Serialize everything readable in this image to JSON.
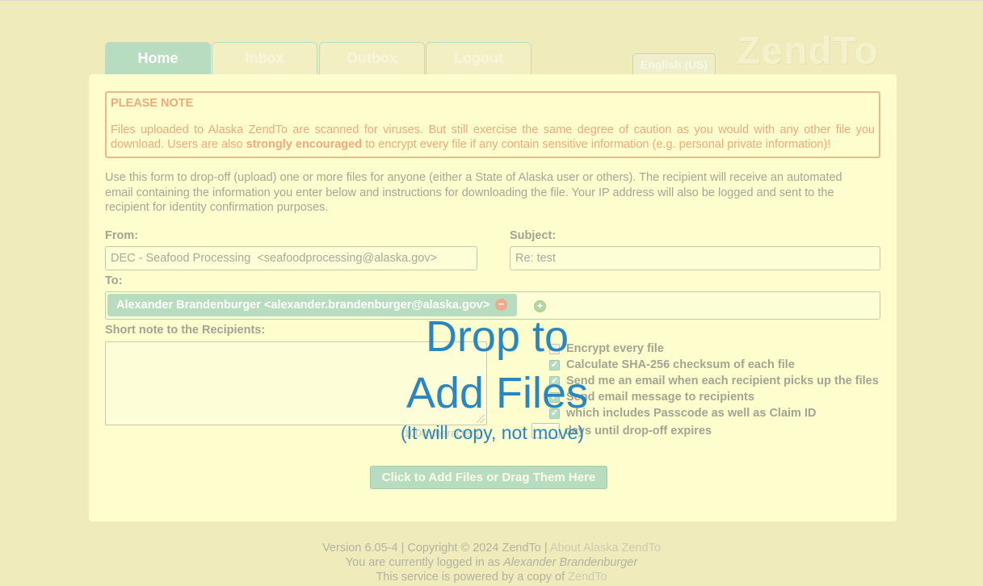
{
  "tabs": [
    {
      "label": "Home",
      "active": true
    },
    {
      "label": "Inbox"
    },
    {
      "label": "Outbox"
    },
    {
      "label": "Logout"
    }
  ],
  "language_button": "English (US)",
  "logo": "ZendTo",
  "notice": {
    "title": "PLEASE NOTE",
    "text_before": "Files uploaded to Alaska ZendTo are scanned for viruses. But still exercise the same degree of caution as you would with any other file you download. Users are also ",
    "text_bold": "strongly encouraged",
    "text_after": " to encrypt every file if any contain sensitive information (e.g. personal private information)!"
  },
  "intro": "Use this form to drop-off (upload) one or more files for anyone (either a State of Alaska user or others). The recipient will receive an automated email containing the information you enter below and instructions for downloading the file. Your IP address will also be logged and sent to the recipient for identity confirmation purposes.",
  "form": {
    "from_label": "From:",
    "from_value": "DEC - Seafood Processing  <seafoodprocessing@alaska.gov>",
    "subject_label": "Subject:",
    "subject_value": "Re: test",
    "to_label": "To:",
    "recipient": "Alexander Brandenburger <alexander.brandenburger@alaska.gov>",
    "note_label": "Short note to the Recipients:"
  },
  "options": [
    {
      "label": "Encrypt every file",
      "checked": false
    },
    {
      "label": "Calculate SHA-256 checksum of each file",
      "checked": true
    },
    {
      "label": "Send me an email when each recipient picks up the files",
      "checked": true
    },
    {
      "label": "Send email message to recipients",
      "checked": true
    },
    {
      "label": "which includes Passcode as well as Claim ID",
      "checked": true
    }
  ],
  "days_label": "days until drop-off expires",
  "char_counter": "1000 characters",
  "upload_button": "Click to Add Files or Drag Them Here",
  "drop_overlay": {
    "line1": "Drop to",
    "line2": "Add Files",
    "line3": "(It will copy, not move)"
  },
  "footer": {
    "version_text": "Version 6.05-4 | Copyright © 2024 ZendTo | ",
    "about_link": "About Alaska ZendTo",
    "logged_in_text": "You are currently logged in as ",
    "user_name": "Alexander Brandenburger",
    "powered_text": "This service is powered by a copy of ",
    "zendto_link": "ZendTo"
  },
  "colors": {
    "background": "#efebba",
    "panel": "#fdfdcd",
    "accent_green": "#b8dcc0",
    "notice": "#eeaa7e",
    "overlay_text": "#2a86c0"
  }
}
